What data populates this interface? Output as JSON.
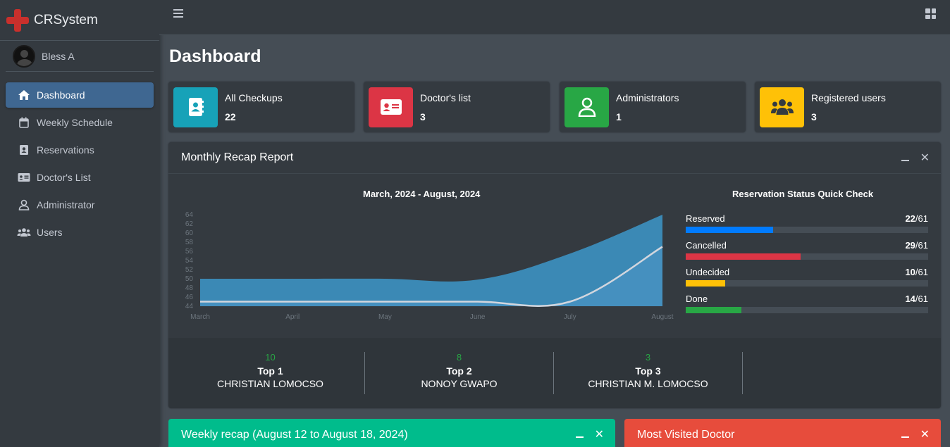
{
  "brand": {
    "name": "CRSystem"
  },
  "user": {
    "name": "Bless A"
  },
  "sidebar": {
    "items": [
      {
        "label": "Dashboard",
        "icon": "home-icon",
        "active": true
      },
      {
        "label": "Weekly Schedule",
        "icon": "calendar-icon"
      },
      {
        "label": "Reservations",
        "icon": "address-book-icon"
      },
      {
        "label": "Doctor's List",
        "icon": "id-card-icon"
      },
      {
        "label": "Administrator",
        "icon": "user-icon"
      },
      {
        "label": "Users",
        "icon": "users-icon"
      }
    ]
  },
  "page": {
    "title": "Dashboard"
  },
  "info_boxes": [
    {
      "label": "All Checkups",
      "value": "22",
      "color": "#17a2b8",
      "icon": "address-book-icon"
    },
    {
      "label": "Doctor's list",
      "value": "3",
      "color": "#dc3545",
      "icon": "id-card-icon"
    },
    {
      "label": "Administrators",
      "value": "1",
      "color": "#28a745",
      "icon": "user-icon"
    },
    {
      "label": "Registered users",
      "value": "3",
      "color": "#ffc107",
      "icon": "users-icon"
    }
  ],
  "recap_card": {
    "title": "Monthly Recap Report",
    "chart_title": "March, 2024 - August, 2024",
    "status_title": "Reservation Status Quick Check"
  },
  "chart_data": {
    "type": "area",
    "title": "March, 2024 - August, 2024",
    "categories": [
      "March",
      "April",
      "May",
      "June",
      "July",
      "August"
    ],
    "ylim": [
      44,
      64
    ],
    "yticks": [
      44,
      46,
      48,
      50,
      52,
      54,
      56,
      58,
      60,
      62,
      64
    ],
    "series": [
      {
        "values": [
          50,
          50,
          50,
          49.8,
          55.5,
          64
        ],
        "color": "#3c8dbc"
      },
      {
        "values": [
          45,
          45,
          45,
          45,
          45,
          57
        ],
        "color": "#d2d6de"
      }
    ]
  },
  "status": [
    {
      "label": "Reserved",
      "count": "22",
      "total": "/61",
      "fraction": 0.36,
      "color": "#007bff"
    },
    {
      "label": "Cancelled",
      "count": "29",
      "total": "/61",
      "fraction": 0.475,
      "color": "#dc3545"
    },
    {
      "label": "Undecided",
      "count": "10",
      "total": "/61",
      "fraction": 0.164,
      "color": "#ffc107"
    },
    {
      "label": "Done",
      "count": "14",
      "total": "/61",
      "fraction": 0.23,
      "color": "#28a745"
    }
  ],
  "top": [
    {
      "count": "10",
      "title": "Top 1",
      "name": "CHRISTIAN LOMOCSO"
    },
    {
      "count": "8",
      "title": "Top 2",
      "name": "NONOY GWAPO"
    },
    {
      "count": "3",
      "title": "Top 3",
      "name": "CHRISTIAN M. LOMOCSO"
    }
  ],
  "bottom_cards": [
    {
      "title": "Weekly recap (August 12 to August 18, 2024)",
      "color": "#00bc8c"
    },
    {
      "title": "Most Visited Doctor",
      "color": "#e74c3c"
    }
  ]
}
